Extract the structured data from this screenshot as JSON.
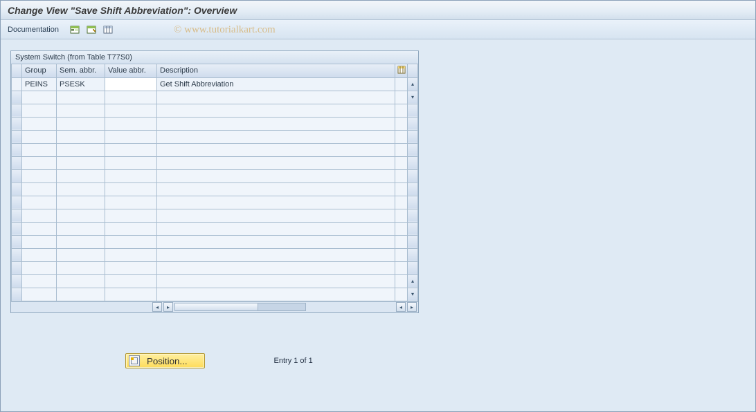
{
  "title": "Change View \"Save Shift Abbreviation\": Overview",
  "toolbar": {
    "documentation_label": "Documentation"
  },
  "watermark": "© www.tutorialkart.com",
  "table": {
    "title": "System Switch (from Table T77S0)",
    "columns": [
      "Group",
      "Sem. abbr.",
      "Value abbr.",
      "Description"
    ],
    "rows": [
      {
        "group": "PEINS",
        "sem": "PSESK",
        "value": "",
        "desc": "Get Shift Abbreviation"
      }
    ],
    "blank_rows": 16
  },
  "footer": {
    "position_label": "Position...",
    "entry_text": "Entry 1 of 1"
  },
  "icons": {
    "tb1": "display-icon",
    "tb2": "save-icon",
    "tb3": "table-settings-icon",
    "cfg": "configure-icon"
  }
}
